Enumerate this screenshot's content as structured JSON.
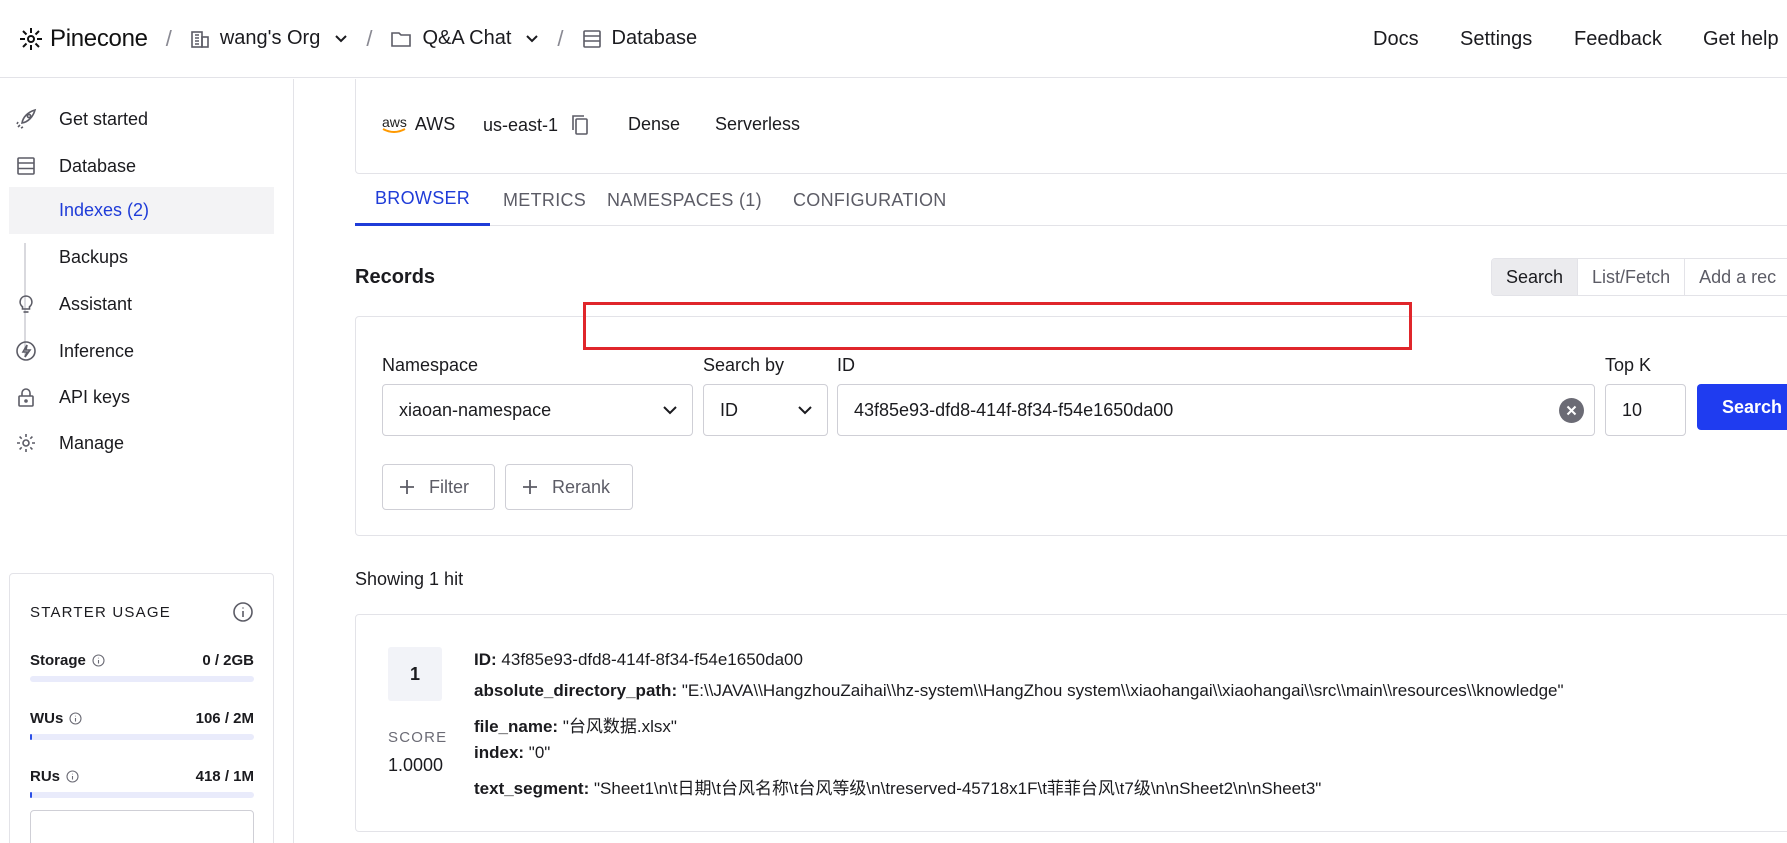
{
  "header": {
    "brand": "Pinecone",
    "separator": "/",
    "org": "wang's Org",
    "project": "Q&A Chat",
    "section": "Database",
    "links": {
      "docs": "Docs",
      "settings": "Settings",
      "feedback": "Feedback",
      "help": "Get help"
    }
  },
  "sidebar": {
    "items": [
      {
        "label": "Get started",
        "icon": "rocket-icon"
      },
      {
        "label": "Database",
        "icon": "database-icon"
      },
      {
        "label": "Assistant",
        "icon": "lightbulb-icon"
      },
      {
        "label": "Inference",
        "icon": "bolt-icon"
      },
      {
        "label": "API keys",
        "icon": "lock-icon"
      },
      {
        "label": "Manage",
        "icon": "gear-icon"
      }
    ],
    "sub_items": [
      {
        "label": "Indexes (2)",
        "active": true
      },
      {
        "label": "Backups",
        "active": false
      }
    ],
    "usage": {
      "title": "STARTER USAGE",
      "rows": [
        {
          "name": "Storage",
          "value": "0 / 2GB",
          "fraction": 0.0
        },
        {
          "name": "WUs",
          "value": "106 / 2M",
          "fraction": 0.0001
        },
        {
          "name": "RUs",
          "value": "418 / 1M",
          "fraction": 0.0004
        }
      ]
    }
  },
  "index_info": {
    "cloud_value": "AWS",
    "aws_logo": "aws",
    "region_value": "us-east-1",
    "type_value": "Dense",
    "capacity_value": "Serverless"
  },
  "tabs": [
    "BROWSER",
    "METRICS",
    "NAMESPACES (1)",
    "CONFIGURATION"
  ],
  "records": {
    "title": "Records",
    "modes": [
      "Search",
      "List/Fetch",
      "Add a rec"
    ]
  },
  "search": {
    "namespace_label": "Namespace",
    "namespace_value": "xiaoan-namespace",
    "search_by_label": "Search by",
    "search_by_value": "ID",
    "id_label": "ID",
    "id_value": "43f85e93-dfd8-414f-8f34-f54e1650da00",
    "topk_label": "Top K",
    "topk_value": "10",
    "search_button": "Search",
    "filter_button": "Filter",
    "rerank_button": "Rerank"
  },
  "results": {
    "showing": "Showing 1 hit",
    "hit": {
      "rank": "1",
      "score_label": "SCORE",
      "score": "1.0000",
      "id_key": "ID:",
      "id_value": "43f85e93-dfd8-414f-8f34-f54e1650da00",
      "path_key": "absolute_directory_path:",
      "path_value": "\"E:\\\\JAVA\\\\HangzhouZaihai\\\\hz-system\\\\HangZhou system\\\\xiaohangai\\\\xiaohangai\\\\src\\\\main\\\\resources\\\\knowledge\"",
      "file_key": "file_name:",
      "file_value": "\"台风数据.xlsx\"",
      "index_key": "index:",
      "index_value": "\"0\"",
      "text_key": "text_segment:",
      "text_value": "\"Sheet1\\n\\t日期\\t台风名称\\t台风等级\\n\\treserved-45718x1F\\t菲菲台风\\t7级\\n\\nSheet2\\n\\nSheet3\"",
      "more": "•••"
    }
  },
  "colors": {
    "accent": "#1f3cd8",
    "primary_button": "#1f3cf0",
    "highlight_border": "#e0262b",
    "usage_bar": "#2b4fe6"
  }
}
